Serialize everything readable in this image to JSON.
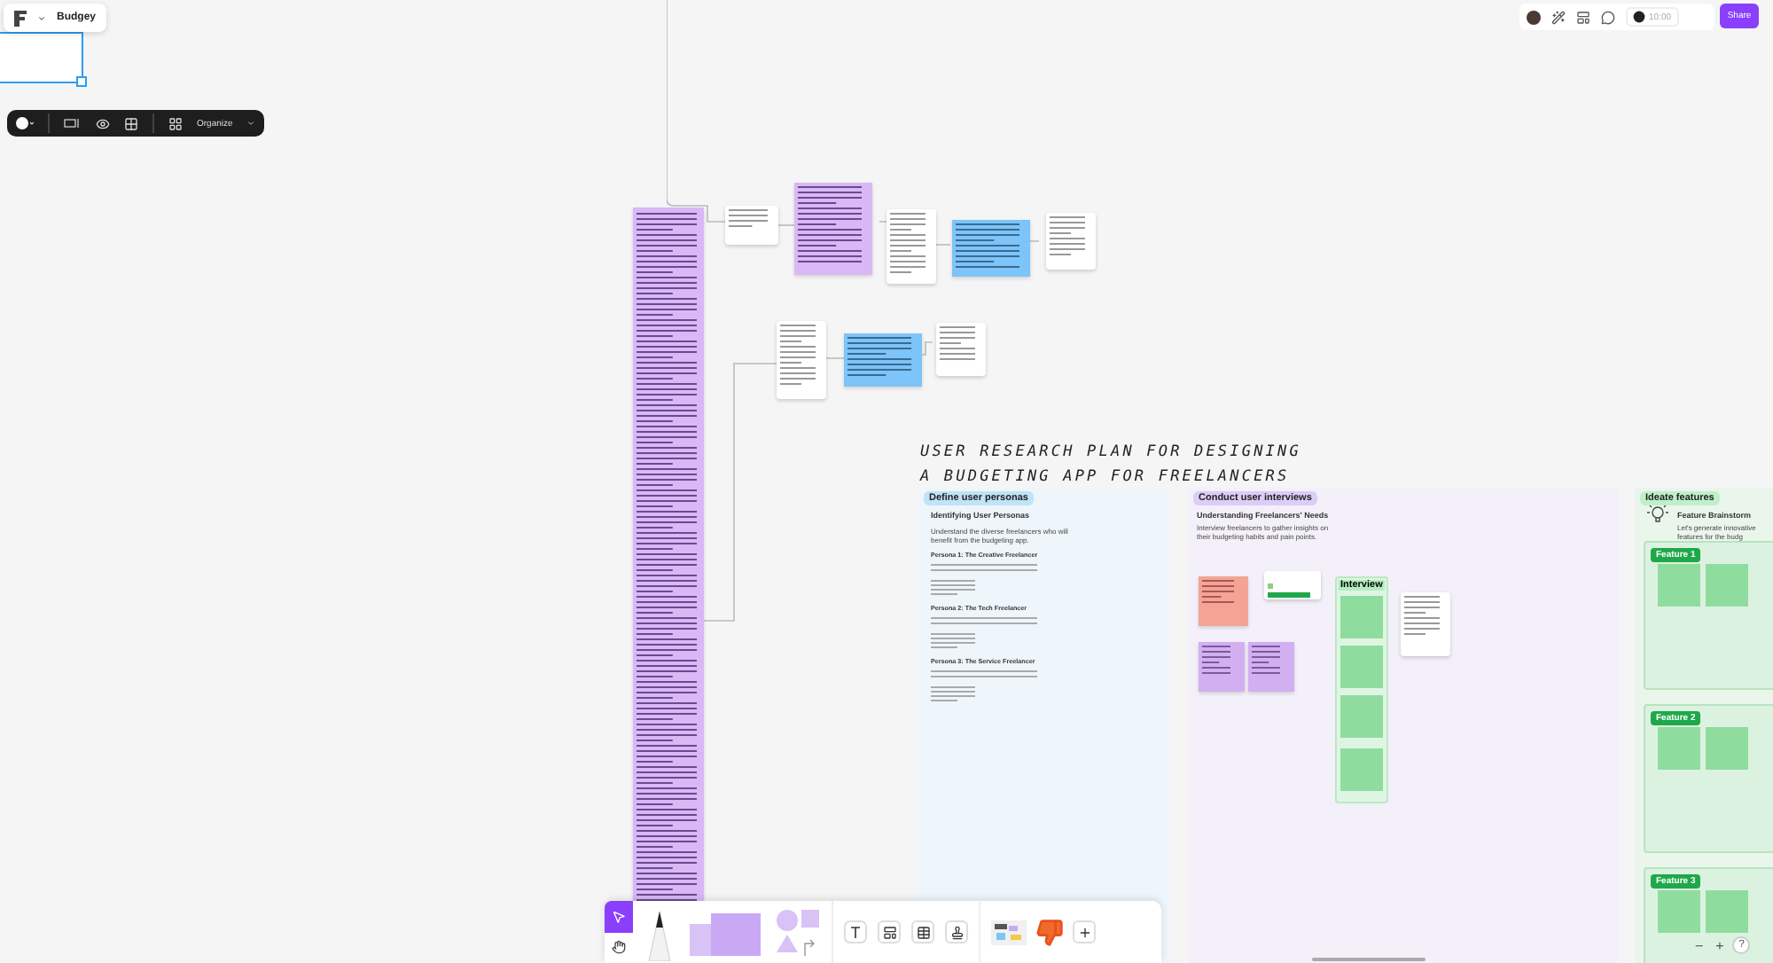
{
  "header": {
    "file_name": "Budgey"
  },
  "selection_toolbar": {
    "organize_label": "Organize"
  },
  "top_bar": {
    "timer": "10:00",
    "share_label": "Share"
  },
  "board_title": [
    "USER RESEARCH PLAN FOR DESIGNING",
    "A BUDGETING APP FOR FREELANCERS"
  ],
  "sections": [
    {
      "kind": "personas",
      "label": "Define user personas",
      "color": "#bfe3f7",
      "heading": "Identifying User Personas",
      "intro": "Understand the diverse freelancers who will benefit from the budgeting app.",
      "personas": [
        "Persona 1: The Creative Freelancer",
        "Persona 2: The Tech Freelancer",
        "Persona 3: The Service Freelancer"
      ]
    },
    {
      "kind": "interviews",
      "label": "Conduct user interviews",
      "color": "#dccdf6",
      "heading": "Understanding Freelancers' Needs",
      "intro": "Interview freelancers to gather insights on their budgeting habits and pain points.",
      "column_label": "Interview"
    },
    {
      "kind": "ideas",
      "label": "Ideate features",
      "color": "#bff0c9",
      "heading": "Feature Brainstorm",
      "intro": "Let's generate innovative features for the budg",
      "features": [
        "Feature 1",
        "Feature 2",
        "Feature 3"
      ]
    }
  ],
  "tools": [
    {
      "kind": "select",
      "selected": true
    },
    {
      "kind": "hand",
      "selected": false
    }
  ],
  "zoom_controls": {
    "zoom_out": "−",
    "zoom_in": "+",
    "help": "?"
  }
}
